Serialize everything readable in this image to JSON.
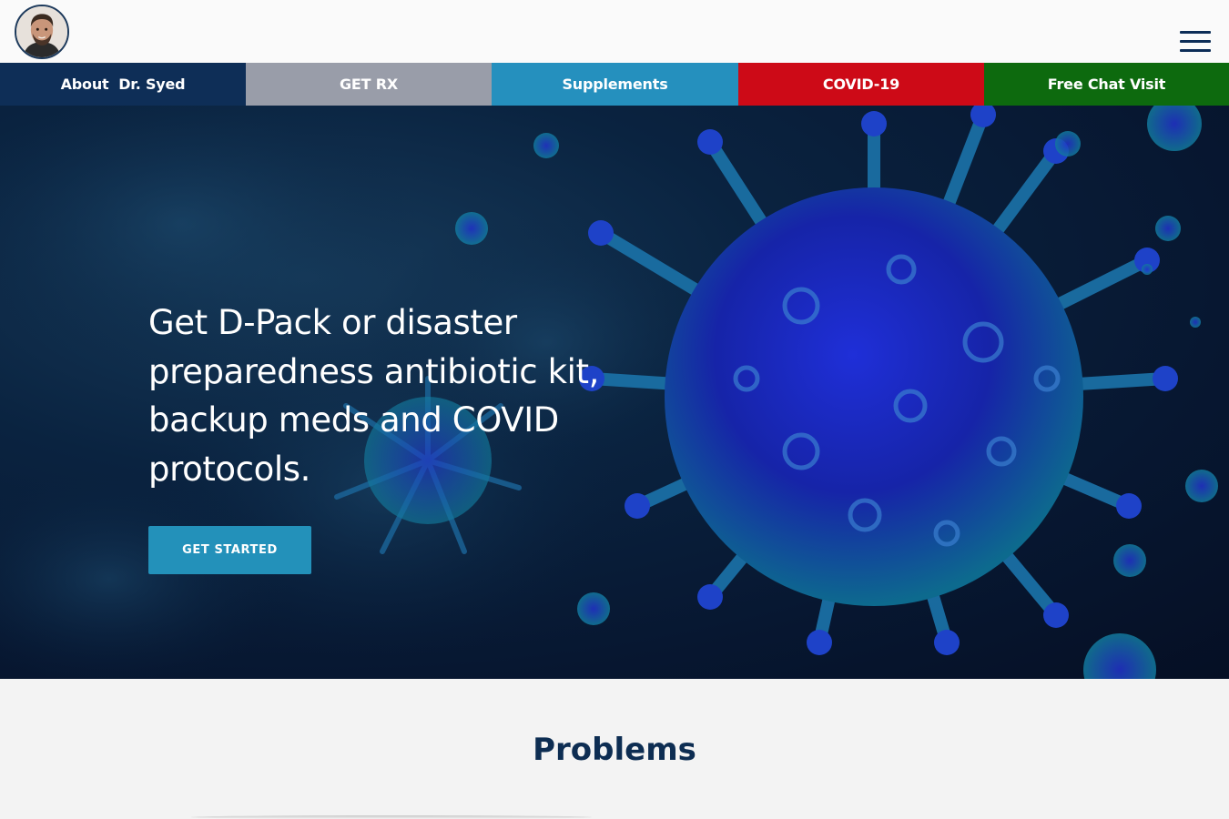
{
  "header": {
    "avatar_icon": "doctor-portrait",
    "menu_icon": "hamburger-menu-icon"
  },
  "nav": {
    "items": [
      {
        "label": "About  Dr. Syed",
        "color": "#0e2e57"
      },
      {
        "label": "GET RX",
        "color": "#999da9"
      },
      {
        "label": "Supplements",
        "color": "#2590be"
      },
      {
        "label": "COVID-19",
        "color": "#cd0a17"
      },
      {
        "label": "Free Chat Visit",
        "color": "#0d6a0e"
      }
    ]
  },
  "hero": {
    "headline": "Get D-Pack or disaster preparedness antibiotic kit, backup meds and COVID protocols.",
    "cta_label": "GET STARTED",
    "cta_color": "#2391ba",
    "background": "coronavirus-illustration"
  },
  "problems": {
    "title": "Problems"
  }
}
